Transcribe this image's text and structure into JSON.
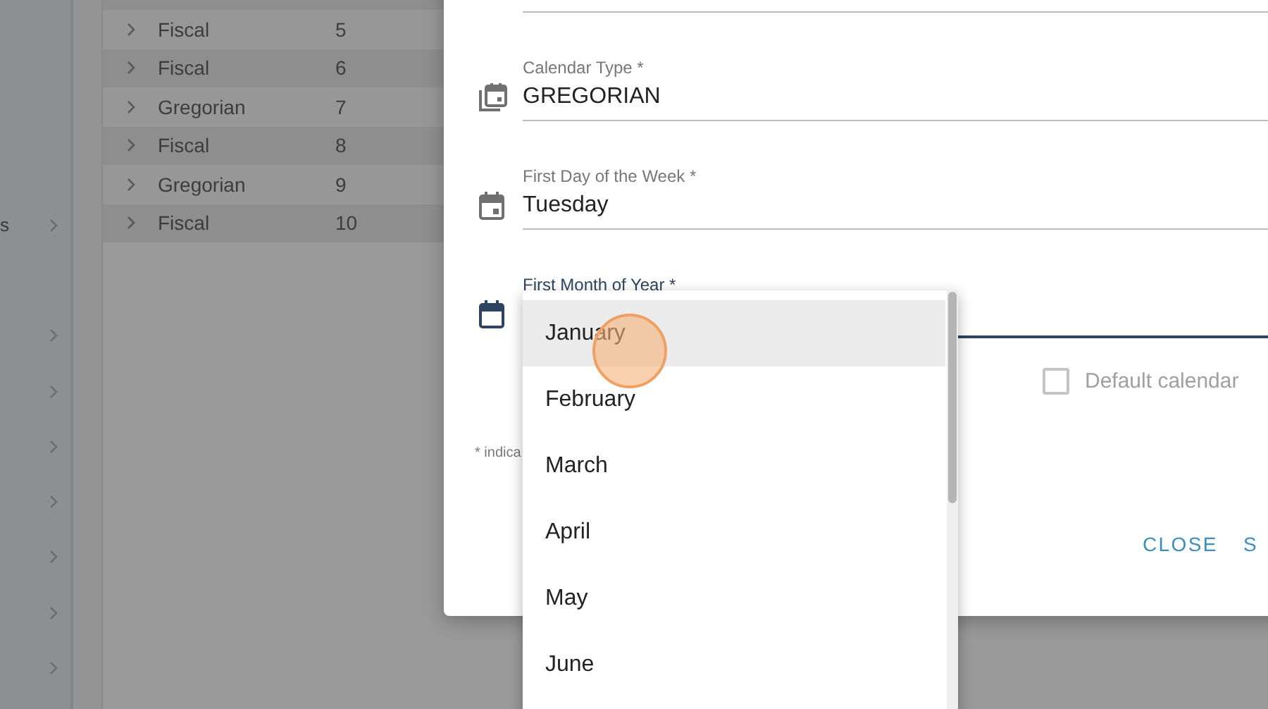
{
  "sidebar": {
    "items": [
      {
        "label": "s",
        "expandable": true
      },
      {
        "expandable": true
      },
      {
        "expandable": true
      },
      {
        "expandable": true
      },
      {
        "expandable": true
      },
      {
        "expandable": true
      },
      {
        "expandable": true
      },
      {
        "expandable": true
      }
    ]
  },
  "table": {
    "rows": [
      {
        "type": "Fiscal",
        "number": "5",
        "expanded": false
      },
      {
        "type": "Fiscal",
        "number": "6",
        "expanded": false
      },
      {
        "type": "Gregorian",
        "number": "7",
        "expanded": false
      },
      {
        "type": "Fiscal",
        "number": "8",
        "expanded": false
      },
      {
        "type": "Gregorian",
        "number": "9",
        "expanded": false
      },
      {
        "type": "Fiscal",
        "number": "10",
        "expanded": false
      }
    ]
  },
  "dialog": {
    "fields": [
      {
        "label": "Calendar Type *",
        "value": "GREGORIAN",
        "focused": false
      },
      {
        "label": "First Day of the Week *",
        "value": "Tuesday",
        "focused": false
      },
      {
        "label": "First Month of Year *",
        "focused": true
      }
    ],
    "default_calendar": {
      "label": "Default calendar",
      "checked": false
    },
    "footnote": "* indica",
    "buttons": [
      "CLOSE",
      "S"
    ]
  },
  "month_menu": {
    "options": [
      {
        "label": "January",
        "highlighted": true
      },
      {
        "label": "February",
        "highlighted": false
      },
      {
        "label": "March",
        "highlighted": false
      },
      {
        "label": "April",
        "highlighted": false
      },
      {
        "label": "May",
        "highlighted": false
      },
      {
        "label": "June",
        "highlighted": false
      }
    ]
  }
}
